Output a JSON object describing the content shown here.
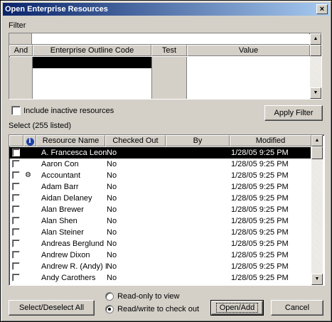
{
  "window": {
    "title": "Open Enterprise Resources",
    "close_glyph": "×"
  },
  "filter": {
    "label": "Filter",
    "columns": [
      "And",
      "Enterprise Outline Code",
      "Test",
      "Value"
    ]
  },
  "include_inactive": {
    "label": "Include inactive resources",
    "checked": false
  },
  "apply_filter_label": "Apply Filter",
  "select": {
    "label": "Select (255 listed)",
    "columns": [
      "",
      "info-icon",
      "Resource Name",
      "Checked Out",
      "By",
      "Modified"
    ],
    "header_labels": {
      "name": "Resource Name",
      "checked_out": "Checked Out",
      "by": "By",
      "modified": "Modified"
    },
    "rows": [
      {
        "name": "A. Francesca Leon",
        "checked_out": "No",
        "by": "",
        "modified": "1/28/05 9:25 PM",
        "selected": true,
        "icon": ""
      },
      {
        "name": "Aaron Con",
        "checked_out": "No",
        "by": "",
        "modified": "1/28/05 9:25 PM",
        "selected": false,
        "icon": ""
      },
      {
        "name": "Accountant",
        "checked_out": "No",
        "by": "",
        "modified": "1/28/05 9:25 PM",
        "selected": false,
        "icon": "generic-resource-icon"
      },
      {
        "name": "Adam Barr",
        "checked_out": "No",
        "by": "",
        "modified": "1/28/05 9:25 PM",
        "selected": false,
        "icon": ""
      },
      {
        "name": "Aidan Delaney",
        "checked_out": "No",
        "by": "",
        "modified": "1/28/05 9:25 PM",
        "selected": false,
        "icon": ""
      },
      {
        "name": "Alan Brewer",
        "checked_out": "No",
        "by": "",
        "modified": "1/28/05 9:25 PM",
        "selected": false,
        "icon": ""
      },
      {
        "name": "Alan Shen",
        "checked_out": "No",
        "by": "",
        "modified": "1/28/05 9:25 PM",
        "selected": false,
        "icon": ""
      },
      {
        "name": "Alan Steiner",
        "checked_out": "No",
        "by": "",
        "modified": "1/28/05 9:25 PM",
        "selected": false,
        "icon": ""
      },
      {
        "name": "Andreas Berglund",
        "checked_out": "No",
        "by": "",
        "modified": "1/28/05 9:25 PM",
        "selected": false,
        "icon": ""
      },
      {
        "name": "Andrew Dixon",
        "checked_out": "No",
        "by": "",
        "modified": "1/28/05 9:25 PM",
        "selected": false,
        "icon": ""
      },
      {
        "name": "Andrew R. (Andy) I",
        "checked_out": "No",
        "by": "",
        "modified": "1/28/05 9:25 PM",
        "selected": false,
        "icon": ""
      },
      {
        "name": "Andy Carothers",
        "checked_out": "No",
        "by": "",
        "modified": "1/28/05 9:25 PM",
        "selected": false,
        "icon": ""
      }
    ]
  },
  "mode": {
    "options": [
      {
        "label": "Read-only to view",
        "selected": false
      },
      {
        "label": "Read/write to check out",
        "selected": true
      }
    ]
  },
  "buttons": {
    "select_deselect": "Select/Deselect All",
    "open_add": "Open/Add",
    "cancel": "Cancel"
  },
  "scroll_arrows": {
    "up": "▲",
    "down": "▼"
  }
}
